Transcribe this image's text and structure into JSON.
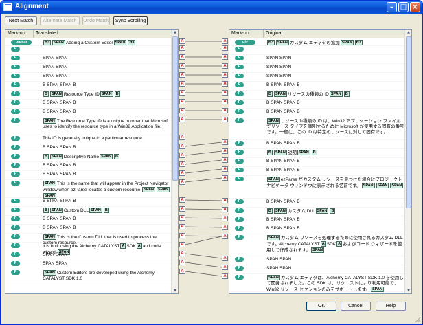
{
  "window": {
    "title": "Alignment"
  },
  "toolbar": {
    "next_match": "Next Match",
    "alternate_match": "Alternate Match",
    "undo_match": "Undo Match",
    "sync_scrolling": "Sync Scrolling"
  },
  "left": {
    "col_markup": "Mark-up",
    "col_text": "Translated",
    "rows": [
      {
        "tag": "param",
        "parts": [
          [
            "t",
            "H3"
          ],
          [
            "t",
            "SPAN"
          ],
          [
            "s",
            "Adding a Custom Editor"
          ],
          [
            "t",
            "SPAN"
          ],
          [
            "t",
            "H3"
          ]
        ]
      },
      {
        "tag": "P",
        "parts": []
      },
      {
        "tag": "P",
        "parts": [
          [
            "s",
            "SPAN  SPAN"
          ]
        ]
      },
      {
        "tag": "P",
        "parts": [
          [
            "s",
            "SPAN  SPAN"
          ]
        ]
      },
      {
        "tag": "P",
        "parts": [
          [
            "s",
            "SPAN  SPAN"
          ]
        ]
      },
      {
        "tag": "P",
        "parts": [
          [
            "s",
            "B   SPAN  SPAN   B"
          ]
        ]
      },
      {
        "tag": "P",
        "parts": [
          [
            "t",
            "B"
          ],
          [
            "t",
            "SPAN"
          ],
          [
            "s",
            "Resource Type ID"
          ],
          [
            "t",
            "SPAN"
          ],
          [
            "t",
            "B"
          ]
        ]
      },
      {
        "tag": "P",
        "parts": [
          [
            "s",
            "B   SPAN  SPAN   B"
          ]
        ]
      },
      {
        "tag": "P",
        "parts": [
          [
            "s",
            "B   SPAN  SPAN   B"
          ]
        ]
      },
      {
        "tag": "P",
        "parts": [
          [
            "t",
            "SPAN"
          ],
          [
            "s",
            "The Resource Type ID is a unique number that Microsoft uses to identify the resource type in a Win32 Application file."
          ]
        ]
      },
      {
        "tag": "P",
        "parts": [
          [
            "s",
            "This ID is generally unique to a particular resource."
          ]
        ]
      },
      {
        "tag": "P",
        "parts": [
          [
            "s",
            "B   SPAN  SPAN   B"
          ]
        ]
      },
      {
        "tag": "P",
        "parts": [
          [
            "t",
            "B"
          ],
          [
            "t",
            "SPAN"
          ],
          [
            "s",
            "Descriptive Name"
          ],
          [
            "t",
            "SPAN"
          ],
          [
            "t",
            "B"
          ]
        ]
      },
      {
        "tag": "P",
        "parts": [
          [
            "s",
            "B   SPAN  SPAN   B"
          ]
        ]
      },
      {
        "tag": "P",
        "parts": [
          [
            "s",
            "B   SPAN  SPAN   B"
          ]
        ]
      },
      {
        "tag": "P",
        "parts": [
          [
            "t",
            "SPAN"
          ],
          [
            "s",
            "This is the name that will appear in the Project Navigator window when ezParse locates a custom resource."
          ],
          [
            "t",
            "SPAN"
          ],
          [
            "t",
            "SPAN"
          ],
          [
            "t",
            "SPAN"
          ]
        ]
      },
      {
        "tag": "P",
        "parts": [
          [
            "s",
            "B   SPAN  SPAN   B"
          ]
        ]
      },
      {
        "tag": "P",
        "parts": [
          [
            "t",
            "B"
          ],
          [
            "t",
            "SPAN"
          ],
          [
            "s",
            "Custom DLL"
          ],
          [
            "t",
            "SPAN"
          ],
          [
            "t",
            "B"
          ]
        ]
      },
      {
        "tag": "P",
        "parts": [
          [
            "s",
            "B   SPAN  SPAN   B"
          ]
        ]
      },
      {
        "tag": "P",
        "parts": [
          [
            "s",
            "B   SPAN  SPAN   B"
          ]
        ]
      },
      {
        "tag": "P",
        "parts": [
          [
            "t",
            "SPAN"
          ],
          [
            "s",
            "This is the Custom DLL that is used to process the custom resource."
          ]
        ]
      },
      {
        "tag": "P",
        "parts": [
          [
            "s",
            "It is built using the Alchemy CATALYST"
          ],
          [
            "t",
            "A"
          ],
          [
            "s",
            "SDK"
          ],
          [
            "t",
            "A"
          ],
          [
            "s",
            "and code wizard."
          ],
          [
            "t",
            "SPAN"
          ]
        ]
      },
      {
        "tag": "P",
        "parts": [
          [
            "s",
            "SPAN  SPAN"
          ]
        ]
      },
      {
        "tag": "P",
        "parts": [
          [
            "s",
            "SPAN  SPAN"
          ]
        ]
      },
      {
        "tag": "P",
        "parts": [
          [
            "t",
            "SPAN"
          ],
          [
            "s",
            "Custom Editors are developed using the Alchemy CATALYST SDK 1.0"
          ]
        ]
      }
    ]
  },
  "right": {
    "col_markup": "Mark-up",
    "col_text": "Original",
    "rows": [
      {
        "tag": "div",
        "parts": [
          [
            "t",
            "H3"
          ],
          [
            "t",
            "SPAN"
          ],
          [
            "s",
            "カスタム エディタの追加"
          ],
          [
            "t",
            "SPAN"
          ],
          [
            "t",
            "H3"
          ]
        ]
      },
      {
        "tag": "P",
        "parts": []
      },
      {
        "tag": "P",
        "parts": [
          [
            "s",
            "SPAN  SPAN"
          ]
        ]
      },
      {
        "tag": "P",
        "parts": [
          [
            "s",
            "SPAN  SPAN"
          ]
        ]
      },
      {
        "tag": "P",
        "parts": [
          [
            "s",
            "SPAN  SPAN"
          ]
        ]
      },
      {
        "tag": "P",
        "parts": [
          [
            "s",
            "B   SPAN  SPAN   B"
          ]
        ]
      },
      {
        "tag": "P",
        "parts": [
          [
            "t",
            "B"
          ],
          [
            "t",
            "SPAN"
          ],
          [
            "s",
            "リソースの種類の ID"
          ],
          [
            "t",
            "SPAN"
          ],
          [
            "t",
            "B"
          ]
        ]
      },
      {
        "tag": "P",
        "parts": [
          [
            "s",
            "B   SPAN  SPAN   B"
          ]
        ]
      },
      {
        "tag": "P",
        "parts": [
          [
            "s",
            "B   SPAN  SPAN   B"
          ]
        ]
      },
      {
        "tag": "P",
        "parts": [
          [
            "t",
            "SPAN"
          ],
          [
            "s",
            "リソースの種類の ID は、Win32 アプリケーション ファイルでリソース タイプを識別するために Microsoft が使用する固有の番号です。一般に、この ID は特定のリソースに対して固有です。"
          ]
        ]
      },
      {
        "tag": "P",
        "parts": [
          [
            "s",
            "B   SPAN  SPAN   B"
          ]
        ]
      },
      {
        "tag": "P",
        "parts": [
          [
            "t",
            "B"
          ],
          [
            "t",
            "SPAN"
          ],
          [
            "s",
            "説明"
          ],
          [
            "t",
            "SPAN"
          ],
          [
            "t",
            "B"
          ]
        ]
      },
      {
        "tag": "P",
        "parts": [
          [
            "s",
            "B   SPAN  SPAN   B"
          ]
        ]
      },
      {
        "tag": "P",
        "parts": [
          [
            "s",
            "B   SPAN  SPAN   B"
          ]
        ]
      },
      {
        "tag": "P",
        "parts": [
          [
            "t",
            "SPAN"
          ],
          [
            "s",
            "ezParse がカスタム リソースを見つけた場合にプロジェクト ナビゲータ ウィンドウに表示される名前です。"
          ],
          [
            "t",
            "SPAN"
          ],
          [
            "t",
            "SPAN"
          ],
          [
            "t",
            "SPAN"
          ]
        ]
      },
      {
        "tag": "P",
        "parts": [
          [
            "s",
            "B   SPAN  SPAN   B"
          ]
        ]
      },
      {
        "tag": "P",
        "parts": [
          [
            "t",
            "B"
          ],
          [
            "t",
            "SPAN"
          ],
          [
            "s",
            "カスタム DLL"
          ],
          [
            "t",
            "SPAN"
          ],
          [
            "t",
            "B"
          ]
        ]
      },
      {
        "tag": "P",
        "parts": [
          [
            "s",
            "B   SPAN  SPAN   B"
          ]
        ]
      },
      {
        "tag": "P",
        "parts": [
          [
            "s",
            "B   SPAN  SPAN   B"
          ]
        ]
      },
      {
        "tag": "P",
        "parts": [
          [
            "t",
            "SPAN"
          ],
          [
            "s",
            "カスタム リソースを処理するために使用されるカスタム DLL です。Alchemy CATALYST"
          ],
          [
            "t",
            "A"
          ],
          [
            "s",
            "SDK"
          ],
          [
            "t",
            "A"
          ],
          [
            "s",
            "およびコード ウィザードを使用して作成されます。"
          ],
          [
            "t",
            "SPAN"
          ]
        ]
      },
      {
        "tag": "P",
        "parts": [
          [
            "s",
            "SPAN  SPAN"
          ]
        ]
      },
      {
        "tag": "P",
        "parts": [
          [
            "s",
            "SPAN  SPAN"
          ]
        ]
      },
      {
        "tag": "P",
        "parts": [
          [
            "t",
            "SPAN"
          ],
          [
            "s",
            "カスタム エディタは、Alchemy CATALYST SDK 1.0 を使用して開発されました。この SDK は、リクエストにより利用可能で、Win32 リソース セクションのみをサポートします。"
          ],
          [
            "t",
            "SPAN"
          ]
        ]
      }
    ]
  },
  "footer": {
    "ok": "OK",
    "cancel": "Cancel",
    "help": "Help"
  },
  "colors": {
    "accent": "#0a5bd8",
    "tag_fill": "#2f9f8c",
    "link_line": "#555555"
  }
}
